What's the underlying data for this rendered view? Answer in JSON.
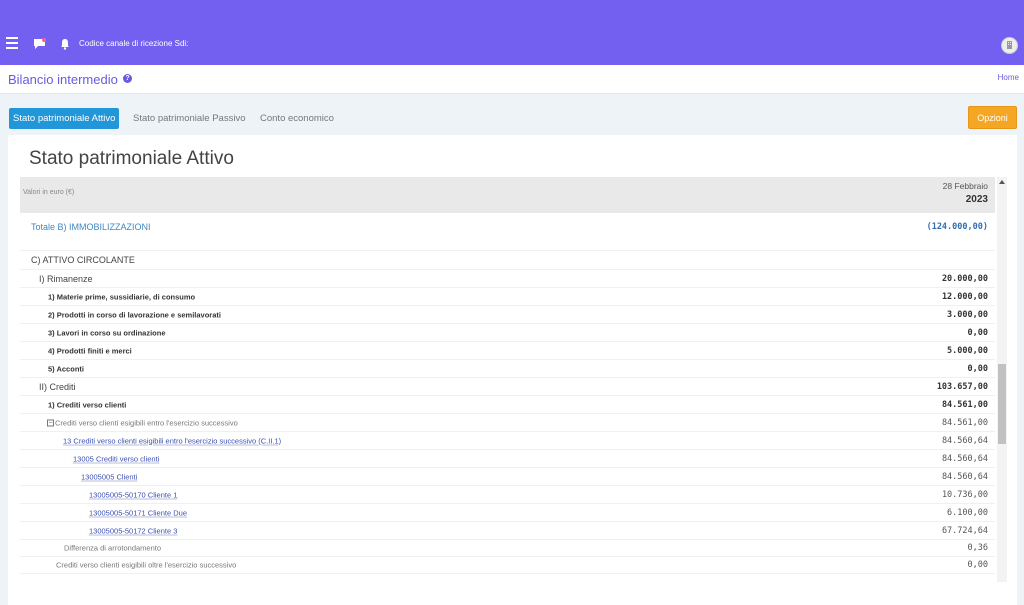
{
  "topbar": {
    "sdi_label": "Codice canale di ricezione Sdi:"
  },
  "page": {
    "title": "Bilancio intermedio",
    "home_link": "Home"
  },
  "tabs": [
    {
      "label": "Stato patrimoniale Attivo",
      "active": true
    },
    {
      "label": "Stato patrimoniale Passivo",
      "active": false
    },
    {
      "label": "Conto economico",
      "active": false
    }
  ],
  "options_button": "Opzioni",
  "panel": {
    "heading": "Stato patrimoniale Attivo",
    "header": {
      "currency_note": "Valori in euro (€)",
      "date": "28 Febbraio",
      "year": "2023"
    },
    "rows": [
      {
        "label": "Totale B) IMMOBILIZZAZIONI",
        "value": "(124.000,00)"
      },
      {
        "label": "C) ATTIVO CIRCOLANTE",
        "value": ""
      },
      {
        "label": "I) Rimanenze",
        "value": "20.000,00"
      },
      {
        "label": "1) Materie prime, sussidiarie, di consumo",
        "value": "12.000,00"
      },
      {
        "label": "2) Prodotti in corso di lavorazione e semilavorati",
        "value": "3.000,00"
      },
      {
        "label": "3) Lavori in corso su ordinazione",
        "value": "0,00"
      },
      {
        "label": "4) Prodotti finiti e merci",
        "value": "5.000,00"
      },
      {
        "label": "5) Acconti",
        "value": "0,00"
      },
      {
        "label": "II) Crediti",
        "value": "103.657,00"
      },
      {
        "label": "1) Crediti verso clienti",
        "value": "84.561,00"
      },
      {
        "label": "Crediti verso clienti esigibili entro l'esercizio successivo",
        "value": "84.561,00"
      },
      {
        "label": "13 Crediti verso clienti esigibili entro l'esercizio successivo (C.II.1)",
        "value": "84.560,64"
      },
      {
        "label": "13005 Crediti verso clienti",
        "value": "84.560,64"
      },
      {
        "label": "13005005 Clienti",
        "value": "84.560,64"
      },
      {
        "label": "13005005-50170 Cliente 1",
        "value": "10.736,00"
      },
      {
        "label": "13005005-50171 Cliente Due",
        "value": "6.100,00"
      },
      {
        "label": "13005005-50172 Cliente 3",
        "value": "67.724,64"
      },
      {
        "label": "Differenza di arrotondamento",
        "value": "0,36"
      },
      {
        "label": "Crediti verso clienti esigibili oltre l'esercizio successivo",
        "value": "0,00"
      }
    ]
  },
  "colors": {
    "topbar": "#7360f0",
    "accent": "#6a5ae0",
    "tab_active": "#2196d8",
    "options": "#f5a623"
  }
}
